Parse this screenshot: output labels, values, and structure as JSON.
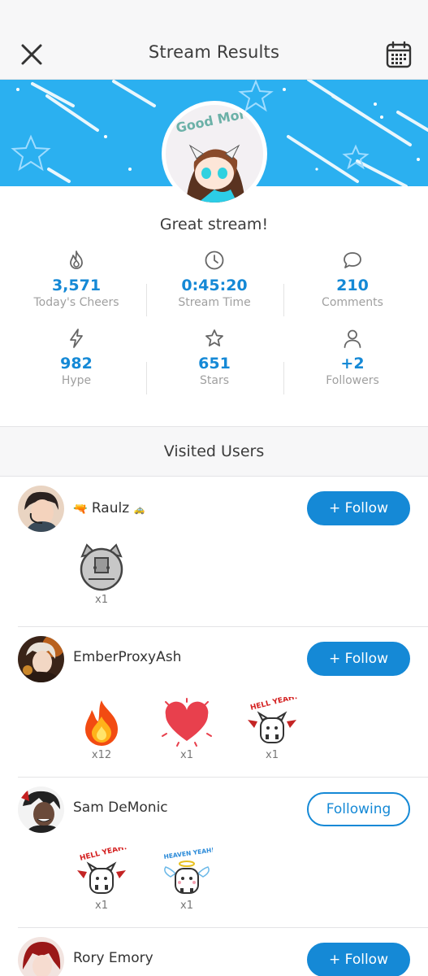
{
  "header": {
    "title": "Stream Results",
    "close_icon": "close-icon",
    "calendar_icon": "calendar-icon"
  },
  "banner": {
    "color": "#2bb0f0",
    "avatar_text": "Good Morning"
  },
  "stream_message": "Great stream!",
  "stats": [
    {
      "icon": "fire-icon",
      "value": "3,571",
      "label": "Today's Cheers"
    },
    {
      "icon": "clock-icon",
      "value": "0:45:20",
      "label": "Stream Time"
    },
    {
      "icon": "comment-icon",
      "value": "210",
      "label": "Comments"
    },
    {
      "icon": "lightning-icon",
      "value": "982",
      "label": "Hype"
    },
    {
      "icon": "star-icon",
      "value": "651",
      "label": "Stars"
    },
    {
      "icon": "person-icon",
      "value": "+2",
      "label": "Followers"
    }
  ],
  "visited_title": "Visited Users",
  "users": [
    {
      "name": "Raulz",
      "button": "+ Follow",
      "gifts": [
        {
          "icon": "robot-cat-gift-icon",
          "count": "x1"
        }
      ]
    },
    {
      "name": "EmberProxyAsh",
      "button": "+ Follow",
      "gifts": [
        {
          "icon": "flame-gift-icon",
          "count": "x12"
        },
        {
          "icon": "heart-gift-icon",
          "count": "x1"
        },
        {
          "icon": "hell-yeah-gift-icon",
          "count": "x1",
          "text": "HELL YEAH!"
        }
      ]
    },
    {
      "name": "Sam DeMonic",
      "button": "Following",
      "gifts": [
        {
          "icon": "hell-yeah-gift-icon",
          "count": "x1",
          "text": "HELL YEAH!"
        },
        {
          "icon": "heaven-yeah-gift-icon",
          "count": "x1",
          "text": "HEAVEN YEAH!"
        }
      ]
    },
    {
      "name": "Rory Emory",
      "button": "+ Follow",
      "gifts": []
    }
  ],
  "colors": {
    "accent": "#1589d6",
    "banner": "#2bb0f0",
    "muted": "#a0a0a0"
  }
}
